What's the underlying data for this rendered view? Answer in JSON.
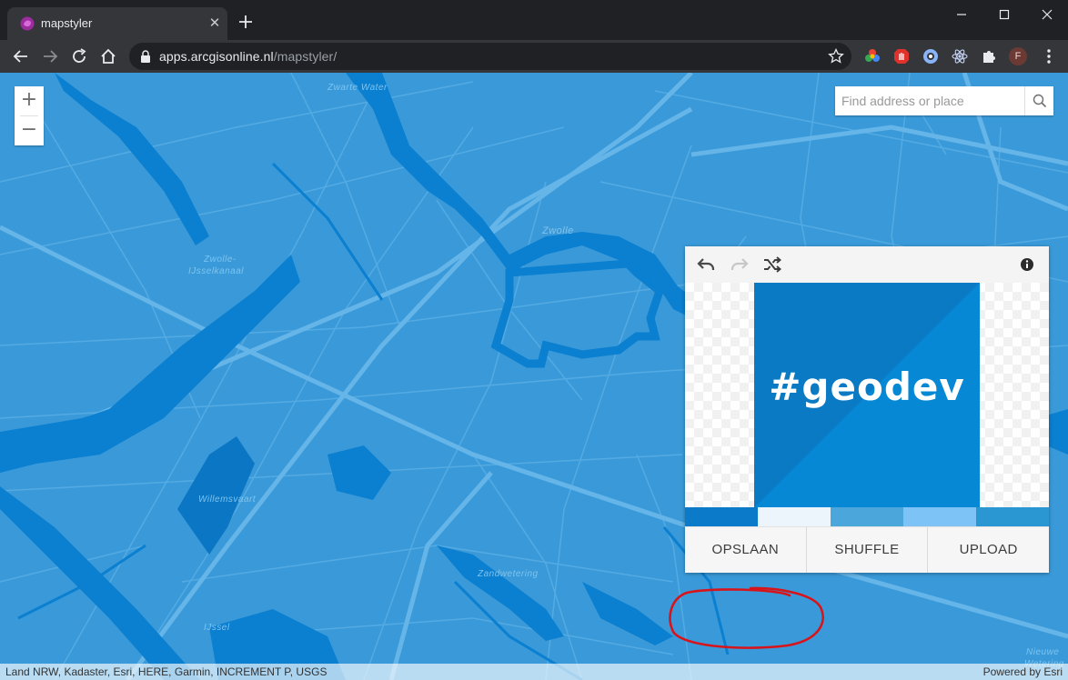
{
  "browser": {
    "tab_title": "mapstyler",
    "tab_close": "✕",
    "url_host": "apps.arcgisonline.nl",
    "url_path": "/mapstyler/",
    "profile_initial": "F"
  },
  "map": {
    "zoom_in": "+",
    "zoom_out": "−",
    "search_placeholder": "Find address or place",
    "labels": {
      "zwarte_water": "Zwarte Water",
      "zwolle": "Zwolle",
      "zwolle_ijsselkanaal_1": "Zwolle-",
      "zwolle_ijsselkanaal_2": "IJsselkanaal",
      "willemsvaart": "Willemsvaart",
      "zandwetering": "Zandwetering",
      "ijssel": "IJssel",
      "nieuwe": "Nieuwe",
      "wetering": "Wetering"
    },
    "attribution_left": "Land NRW, Kadaster, Esri, HERE, Garmin, INCREMENT P, USGS",
    "attribution_right": "Powered by Esri",
    "colors": {
      "land": "#3a9ad9",
      "water": "#0b7fd0",
      "roads": "#5aaee4"
    }
  },
  "styler": {
    "logo_text": "#geodev",
    "swatch_colors": [
      "#0b7ac9",
      "#ebf5fb",
      "#4aa6db",
      "#7ec3f5",
      "#2a97d2"
    ],
    "buttons": {
      "save": "OPSLAAN",
      "shuffle": "SHUFFLE",
      "upload": "UPLOAD"
    }
  }
}
